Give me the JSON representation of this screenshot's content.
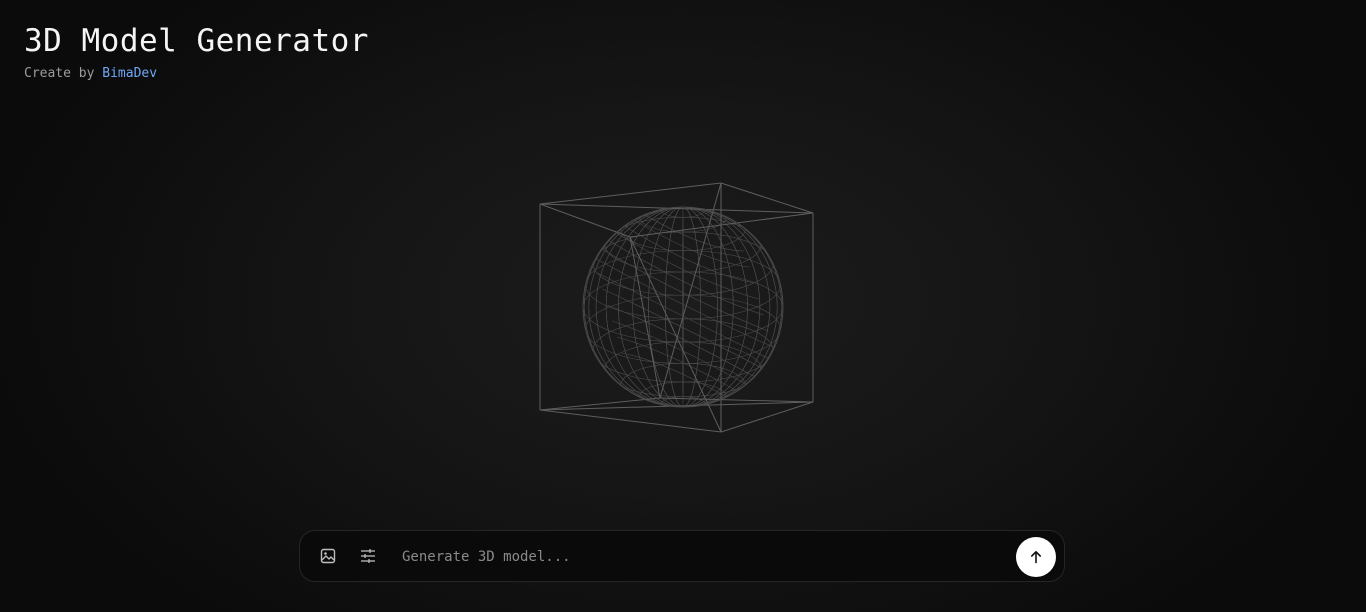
{
  "header": {
    "title": "3D Model Generator",
    "subtitle_prefix": "Create by",
    "author": "BimaDev"
  },
  "viewport": {
    "model": "wireframe sphere inside wireframe cube",
    "line_color": "#5e5e5e"
  },
  "prompt": {
    "placeholder": "Generate 3D model...",
    "value": "",
    "image_icon": "image-icon",
    "settings_icon": "sliders-icon",
    "send_icon": "arrow-up-icon"
  },
  "colors": {
    "accent_link": "#6ea8f7",
    "send_button_bg": "#ffffff"
  }
}
